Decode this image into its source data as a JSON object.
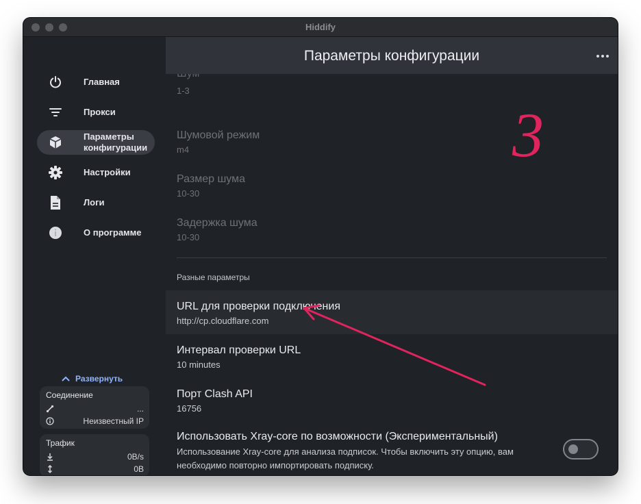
{
  "window": {
    "title": "Hiddify"
  },
  "sidebar": {
    "items": [
      {
        "label": "Главная",
        "icon": "power-icon",
        "active": false
      },
      {
        "label": "Прокси",
        "icon": "filter-icon",
        "active": false
      },
      {
        "label": "Параметры\nконфигурации",
        "icon": "box-icon",
        "active": true
      },
      {
        "label": "Настройки",
        "icon": "gear-icon",
        "active": false
      },
      {
        "label": "Логи",
        "icon": "document-icon",
        "active": false
      },
      {
        "label": "О программе",
        "icon": "info-icon",
        "active": false
      }
    ],
    "expand_label": "Развернуть",
    "connection": {
      "title": "Соединение",
      "ping_value": "...",
      "ip_value": "Неизвестный IP"
    },
    "traffic": {
      "title": "Трафик",
      "speed_value": "0B/s",
      "total_value": "0B"
    }
  },
  "main": {
    "title": "Параметры конфигурации",
    "cut_title": "Шум",
    "dim_settings": [
      {
        "title": "",
        "value": "1-3"
      },
      {
        "title": "Шумовой режим",
        "value": "m4"
      },
      {
        "title": "Размер шума",
        "value": "10-30"
      },
      {
        "title": "Задержка шума",
        "value": "10-30"
      }
    ],
    "section_title": "Разные параметры",
    "settings": [
      {
        "title": "URL для проверки подключения",
        "value": "http://cp.cloudflare.com"
      },
      {
        "title": "Интервал проверки URL",
        "value": "10 minutes"
      },
      {
        "title": "Порт Clash API",
        "value": "16756"
      }
    ],
    "xray": {
      "title": "Использовать Xray-core по возможности (Экспериментальный)",
      "description": "Использование Xray-core для анализа подписок. Чтобы включить эту опцию, вам необходимо повторно импортировать подписку.",
      "enabled": false
    }
  },
  "annotations": {
    "number_label": "3",
    "color": "#e0245e"
  },
  "colors": {
    "window_bg": "#1f2226",
    "header_bg": "#30343a",
    "active_item_bg": "#3a3d44",
    "accent": "#8fb4ff"
  }
}
